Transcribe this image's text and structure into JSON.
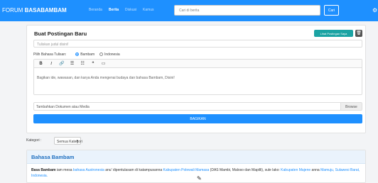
{
  "navbar": {
    "brand_prefix": "FORUM",
    "brand_name": "BASABAMBAM",
    "links": [
      "Beranda",
      "Berita",
      "Diskusi",
      "Kamus"
    ],
    "search_placeholder": "Cari di berita",
    "search_button": "Cari",
    "settings_icon": "gear-icon"
  },
  "post_form": {
    "title": "Buat Postingan Baru",
    "my_posts_button": "Lihat Postingan Saya",
    "delete_icon": "trash-icon",
    "title_placeholder": "Tuliskan judul disini!",
    "language_label": "Pilih Bahasa Tulisan:",
    "language_options": [
      "Bambam",
      "Indonesia"
    ],
    "language_selected": "Bambam",
    "toolbar_icons": [
      "bold-icon",
      "italic-icon",
      "link-icon",
      "bullet-list-icon",
      "numbered-list-icon",
      "quote-icon",
      "image-icon"
    ],
    "toolbar_glyphs": [
      "B",
      "I",
      "🔗",
      "☰",
      "☷",
      "❝",
      "▭"
    ],
    "editor_placeholder": "Bagikan ide, wawasan, dan karya Anda mengenai budaya dan bahasa Bambam, Disini!",
    "media_label": "Tambahkan Dokumen atau Media",
    "browse_button": "Browse",
    "submit_button": "BAGIKAN"
  },
  "filter": {
    "label": "Kategori :",
    "selected": "Semua Kategori"
  },
  "article": {
    "heading": "Bahasa Bambam",
    "body": {
      "t1": "Basa Bambam",
      "t2": " iam mesa ",
      "t3": "bahasa Austronesia",
      "t4": " anu' dipentulasam di katampusanna ",
      "t5": "Kabupaten Polewali Mamasa",
      "t6": " (DAS Mambi, Maloso dan Mapilli), sule lako: ",
      "t7": "Kabupaten Majene",
      "t8": " anna ",
      "t9": "Mamuju, Sulawesi Barat, Indonesia."
    }
  }
}
